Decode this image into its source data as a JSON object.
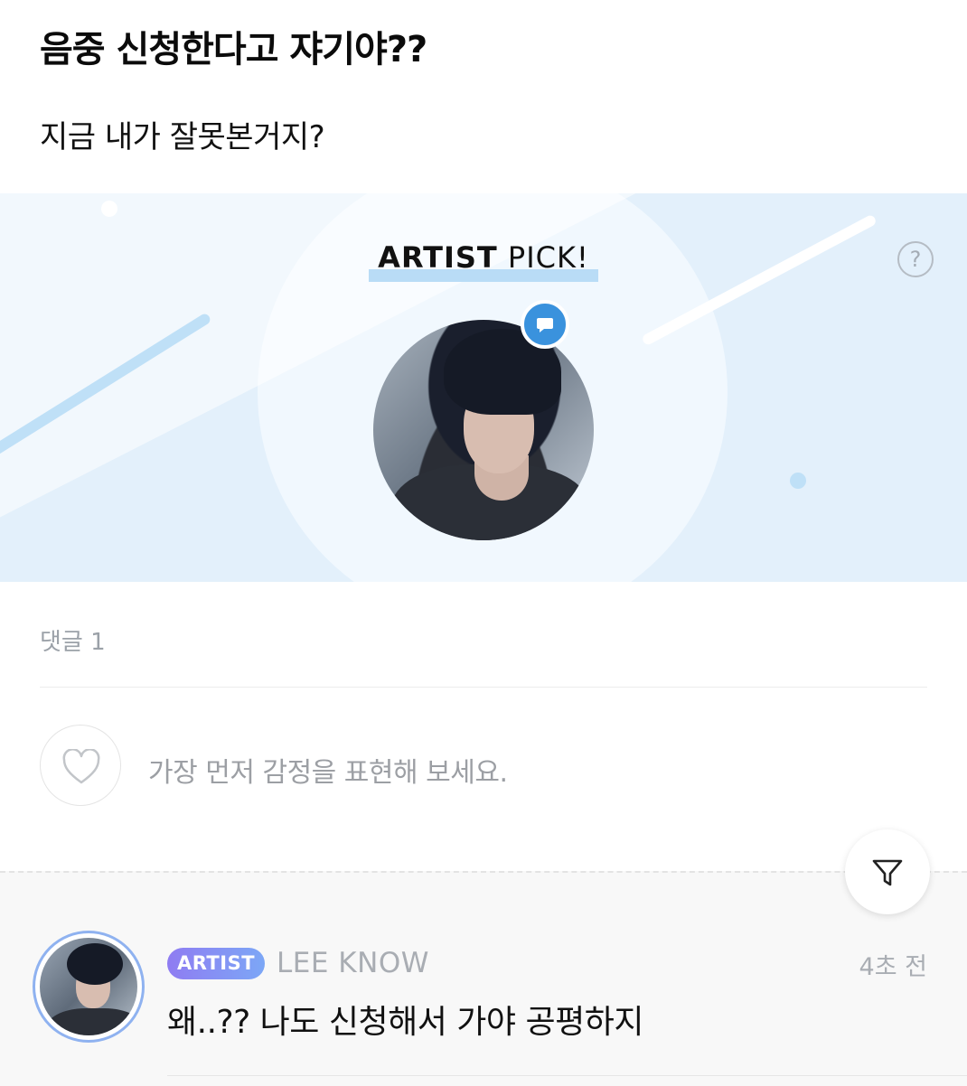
{
  "post": {
    "title": "음중 신청한다고 쟈기야??",
    "body": "지금 내가 잘못본거지?"
  },
  "artist_pick": {
    "title_bold": "ARTIST",
    "title_rest": " PICK!",
    "help_icon": "?",
    "accent_color": "#3a92dd",
    "background_color": "#e3f0fb"
  },
  "comments": {
    "count_label": "댓글 1",
    "reaction_prompt": "가장 먼저 감정을 표현해 보세요.",
    "items": [
      {
        "badge": "ARTIST",
        "author": "LEE KNOW",
        "time": "4초 전",
        "text": "왜..?? 나도 신청해서 가야 공평하지"
      }
    ]
  },
  "icons": {
    "help": "question-circle-icon",
    "chat": "chat-bubble-icon",
    "heart": "heart-icon",
    "filter": "filter-icon"
  }
}
